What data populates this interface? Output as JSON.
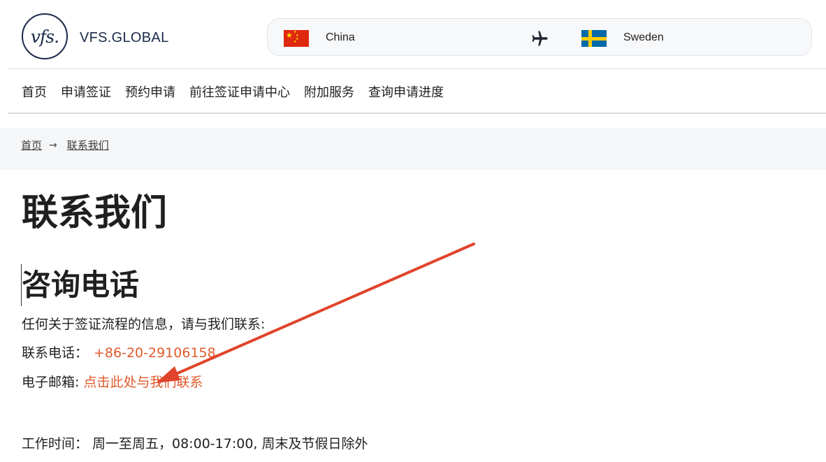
{
  "header": {
    "logo_text": "vfs.",
    "brand": "VFS.GLOBAL",
    "route": {
      "from": "China",
      "to": "Sweden"
    }
  },
  "nav": {
    "items": [
      "首页",
      "申请签证",
      "预约申请",
      "前往签证申请中心",
      "附加服务",
      "查询申请进度"
    ]
  },
  "breadcrumb": {
    "home": "首页",
    "current": "联系我们"
  },
  "page": {
    "title": "联系我们",
    "section_title": "咨询电话",
    "intro": "任何关于签证流程的信息，请与我们联系:",
    "phone_label": "联系电话：",
    "phone_value": "+86-20-29106158",
    "email_label": "电子邮箱:",
    "email_link": "点击此处与我们联系",
    "hours": "工作时间： 周一至周五，08:00-17:00, 周末及节假日除外"
  },
  "colors": {
    "accent": "#e05a2b",
    "brand": "#1a2b49",
    "annotation_arrow": "#e0432b"
  },
  "icons": {
    "route_separator": "airplane-icon",
    "breadcrumb_separator": "arrow-right-icon"
  }
}
